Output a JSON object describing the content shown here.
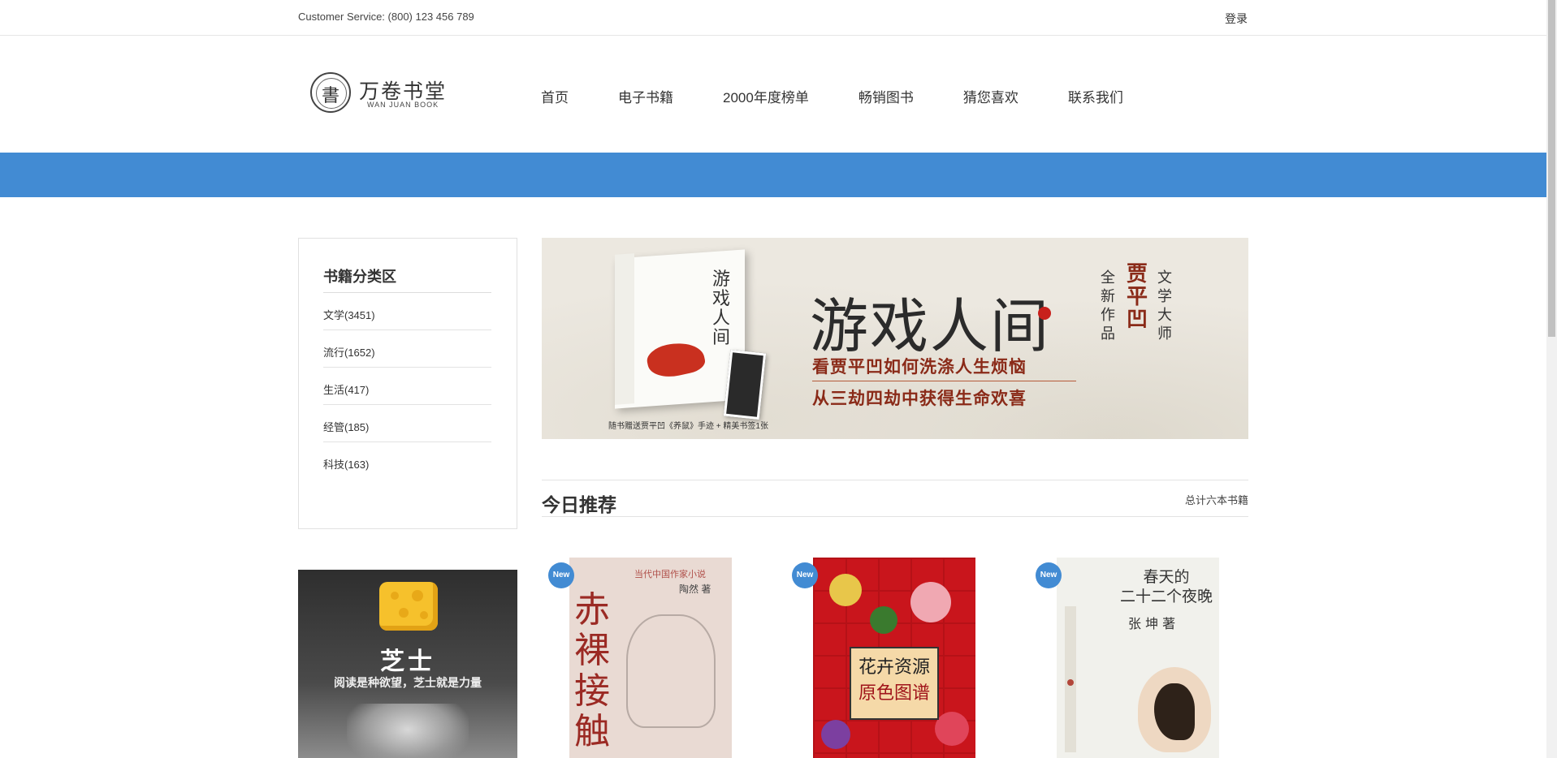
{
  "topbar": {
    "customer_service": "Customer Service: (800) 123 456 789",
    "login": "登录"
  },
  "logo": {
    "seal_char": "書",
    "name_cn": "万卷书堂",
    "name_en": "WAN JUAN BOOK"
  },
  "nav": {
    "items": [
      "首页",
      "电子书籍",
      "2000年度榜单",
      "畅销图书",
      "猜您喜欢",
      "联系我们"
    ]
  },
  "sidebar": {
    "title": "书籍分类区",
    "categories": [
      "文学(3451)",
      "流行(1652)",
      "生活(417)",
      "经管(185)",
      "科技(163)"
    ]
  },
  "banner": {
    "headline": "游戏人间",
    "book_title": "游戏人间",
    "line1": "看贾平凹如何洗涤人生烦恼",
    "line2": "从三劫四劫中获得生命欢喜",
    "col_quanxin": "全新作品",
    "col_author": "贾平凹",
    "col_wenxue": "文学大师",
    "footnote": "随书赠送贾平凹《养鼠》手迹 + 精美书签1张"
  },
  "section": {
    "title": "今日推荐",
    "total": "总计六本书籍"
  },
  "ad": {
    "brand": "芝士",
    "slogan": "阅读是种欲望，芝士就是力量"
  },
  "books": [
    {
      "badge": "New",
      "title": "赤裸接触",
      "header": "当代中国作家小说",
      "author": "陶然 著"
    },
    {
      "badge": "New",
      "title_line1": "花卉资源",
      "title_line2": "原色图谱"
    },
    {
      "badge": "New",
      "title_line1": "春天的",
      "title_line2": "二十二个夜晚",
      "author": "张 坤 著"
    }
  ],
  "colors": {
    "accent_blue": "#428bd3",
    "banner_red": "#8a2a18"
  }
}
